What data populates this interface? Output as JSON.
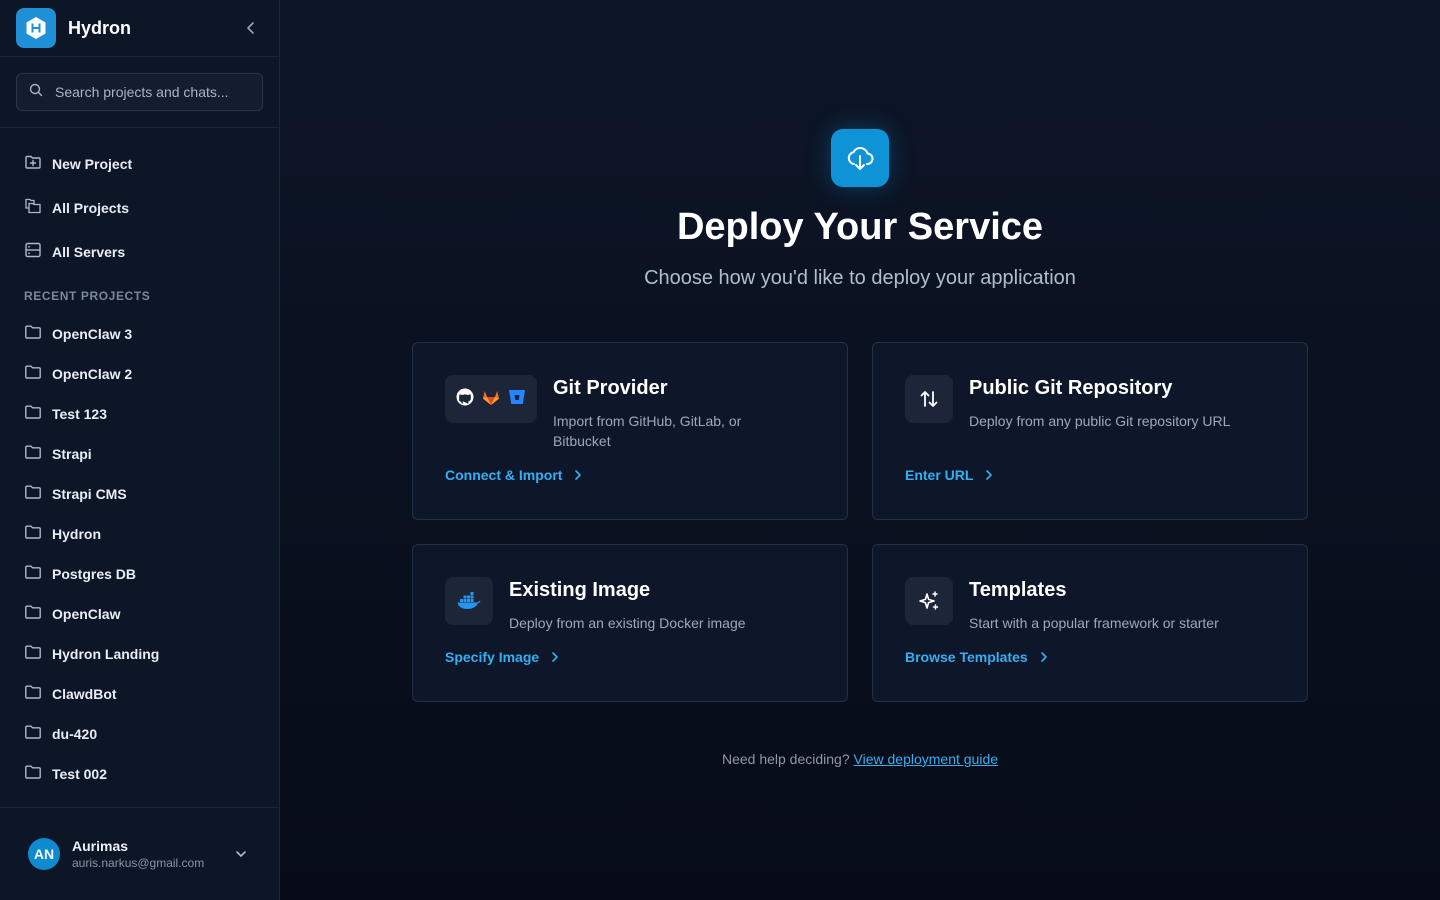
{
  "app": {
    "name": "Hydron"
  },
  "sidebar": {
    "search_placeholder": "Search projects and chats...",
    "nav": [
      {
        "label": "New Project",
        "icon": "folder-plus-icon"
      },
      {
        "label": "All Projects",
        "icon": "folders-icon"
      },
      {
        "label": "All Servers",
        "icon": "server-icon"
      }
    ],
    "recent_label": "RECENT PROJECTS",
    "projects": [
      "OpenClaw 3",
      "OpenClaw 2",
      "Test 123",
      "Strapi",
      "Strapi CMS",
      "Hydron",
      "Postgres DB",
      "OpenClaw",
      "Hydron Landing",
      "ClawdBot",
      "du-420",
      "Test 002"
    ],
    "user": {
      "initials": "AN",
      "name": "Aurimas",
      "email": "auris.narkus@gmail.com"
    }
  },
  "main": {
    "title": "Deploy Your Service",
    "subtitle": "Choose how you'd like to deploy your application",
    "cards": {
      "git": {
        "title": "Git Provider",
        "desc": "Import from GitHub, GitLab, or Bitbucket",
        "link": "Connect & Import"
      },
      "public": {
        "title": "Public Git Repository",
        "desc": "Deploy from any public Git repository URL",
        "link": "Enter URL"
      },
      "image": {
        "title": "Existing Image",
        "desc": "Deploy from an existing Docker image",
        "link": "Specify Image"
      },
      "templates": {
        "title": "Templates",
        "desc": "Start with a popular framework or starter",
        "link": "Browse Templates"
      }
    },
    "help_text": "Need help deciding?",
    "help_link": "View deployment guide"
  },
  "colors": {
    "accent": "#35aef2",
    "brand": "#1f8fd6",
    "background": "#060b18",
    "sidebar": "#0d1627"
  }
}
